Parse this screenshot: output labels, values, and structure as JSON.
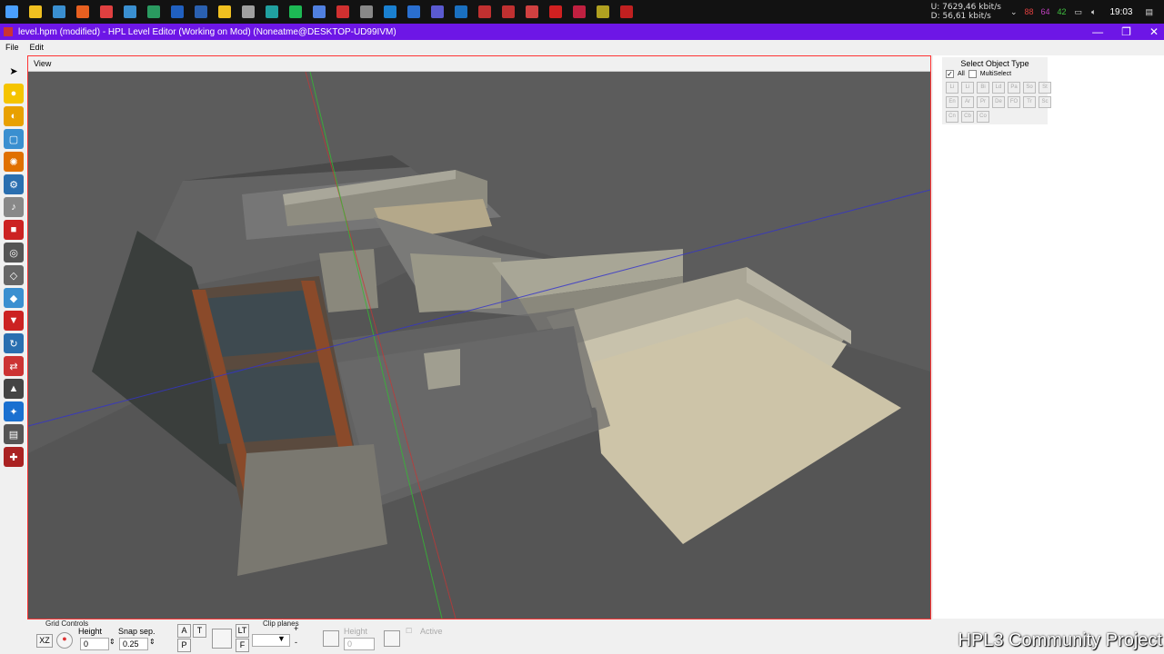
{
  "taskbar": {
    "icons": [
      "windows-icon",
      "explorer-icon",
      "store-icon",
      "firefox-icon",
      "chrome-icon",
      "edge-icon",
      "terminal-icon",
      "photoshop-icon",
      "word-icon",
      "folder-icon",
      "steam-icon",
      "app-icon",
      "spotify-icon",
      "tool-icon",
      "bug-icon",
      "settings-icon",
      "visual-studio-icon",
      "h-icon",
      "store2-icon",
      "vs-icon",
      "app2-icon",
      "app3-icon",
      "app4-icon",
      "app5-icon",
      "app6-icon",
      "app7-icon",
      "app8-icon"
    ],
    "net_up": "7629,46 kbit/s",
    "net_down": "56,61 kbit/s",
    "net_up_label": "U:",
    "net_down_label": "D:",
    "tray_numbers": [
      "88",
      "64",
      "42"
    ],
    "clock": "19:03"
  },
  "window": {
    "title": "level.hpm (modified) - HPL Level Editor (Working on Mod)  (Noneatme@DESKTOP-UD99IVM)",
    "minimize": "—",
    "restore": "❐",
    "close": "✕"
  },
  "menu": [
    "File",
    "Edit"
  ],
  "toolbox": [
    {
      "name": "select-tool",
      "color": "#f0f0f0",
      "glyph": "➤"
    },
    {
      "name": "light-tool",
      "color": "#f5c400",
      "glyph": "●"
    },
    {
      "name": "billboard-tool",
      "color": "#e8a000",
      "glyph": "◐"
    },
    {
      "name": "box-tool",
      "color": "#3a8fd0",
      "glyph": "▢"
    },
    {
      "name": "particle-tool",
      "color": "#e07000",
      "glyph": "✺"
    },
    {
      "name": "entity-tool",
      "color": "#2a6fb0",
      "glyph": "⚙"
    },
    {
      "name": "sound-tool",
      "color": "#888888",
      "glyph": "♪"
    },
    {
      "name": "static-object-tool",
      "color": "#cc2222",
      "glyph": "■"
    },
    {
      "name": "area-tool",
      "color": "#555555",
      "glyph": "◎"
    },
    {
      "name": "primitive-tool",
      "color": "#666666",
      "glyph": "◇"
    },
    {
      "name": "decal-tool",
      "color": "#3a8fd0",
      "glyph": "◆"
    },
    {
      "name": "fog-tool",
      "color": "#cc2222",
      "glyph": "▼"
    },
    {
      "name": "rotate-tool",
      "color": "#2a6fb0",
      "glyph": "↻"
    },
    {
      "name": "combine-tool",
      "color": "#cc3333",
      "glyph": "⇄"
    },
    {
      "name": "terrain-tool",
      "color": "#444444",
      "glyph": "▲"
    },
    {
      "name": "world-tool",
      "color": "#1a70d0",
      "glyph": "✦"
    },
    {
      "name": "misc-tool",
      "color": "#555555",
      "glyph": "▤"
    },
    {
      "name": "pick-tool",
      "color": "#aa2222",
      "glyph": "✚"
    }
  ],
  "viewport": {
    "tab": "View"
  },
  "side_panel": {
    "select_object_type": "Select Object Type",
    "all_label": "All",
    "multiselect_label": "MultiSelect",
    "all_checked": "✓",
    "type_buttons": [
      "Li",
      "Li",
      "Bi",
      "Ld",
      "Pa",
      "So",
      "St",
      "En",
      "Ar",
      "Pr",
      "De",
      "FO",
      "Tr",
      "Sc",
      "Cn",
      "Cb",
      "Co"
    ]
  },
  "bottom": {
    "grid_controls": "Grid Controls",
    "plane": "XZ",
    "height_label": "Height",
    "height_value": "0",
    "snap_label": "Snap sep.",
    "snap_value": "0.25",
    "btn_a": "A",
    "btn_t": "T",
    "btn_p": "P",
    "btn_lt": "LT",
    "btn_f": "F",
    "clip_planes": "Clip planes",
    "clip_add": "+",
    "clip_remove": "-",
    "clip_height_label": "Height",
    "clip_height_value": "0",
    "active_label": "Active"
  },
  "watermark": "HPL3 Community Project"
}
